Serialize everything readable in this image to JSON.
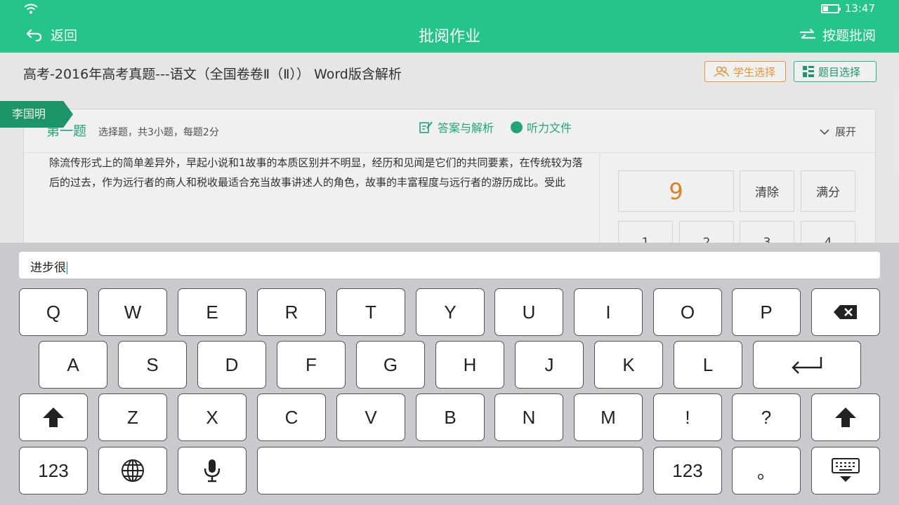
{
  "status": {
    "time": "13:47"
  },
  "header": {
    "back_label": "返回",
    "title": "批阅作业",
    "by_question_label": "按题批阅"
  },
  "content": {
    "doc_title": "高考-2016年高考真题---语文（全国卷卷Ⅱ（Ⅱ）） Word版含解析",
    "student_select": "学生选择",
    "question_select": "题目选择",
    "question": {
      "title": "第一题",
      "subtitle": "选择题，共3小题，每题2分",
      "expand": "展开",
      "student_name": "李国明",
      "answer_link": "答案与解析",
      "audio_link": "听力文件",
      "paragraph": "除流传形式上的简单差异外，早起小说和1故事的本质区别并不明显，经历和见闻是它们的共同要素，在传统较为落后的过去，作为远行者的商人和税收最适合充当故事讲述人的角色，故事的丰富程度与远行者的游历成比。受此"
    },
    "score": {
      "value": "9",
      "clear": "清除",
      "full": "满分",
      "digits": [
        "1",
        "2",
        "3",
        "4"
      ]
    }
  },
  "keyboard": {
    "input_value": "进步很",
    "row1": [
      "Q",
      "W",
      "E",
      "R",
      "T",
      "Y",
      "U",
      "I",
      "O",
      "P"
    ],
    "row2": [
      "A",
      "S",
      "D",
      "F",
      "G",
      "H",
      "J",
      "K",
      "L"
    ],
    "row3": [
      "Z",
      "X",
      "C",
      "V",
      "B",
      "N",
      "M",
      "!",
      "?"
    ],
    "num_left": "123",
    "num_right": "123",
    "period": "。"
  },
  "colors": {
    "brand": "#24c48a",
    "score": "#e58a2b",
    "student_btn": "#f0a040"
  }
}
